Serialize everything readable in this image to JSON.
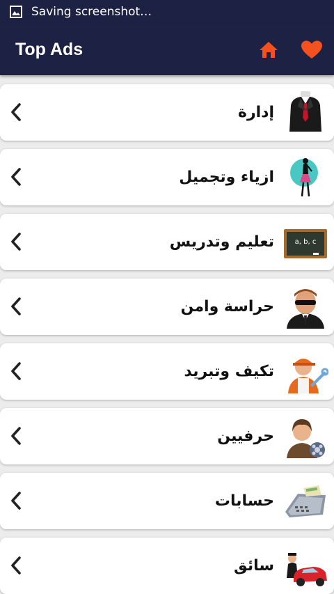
{
  "status_bar": {
    "text": "Saving screenshot…",
    "icon": "image-icon"
  },
  "app_bar": {
    "title": "Top Ads",
    "accent": "#f4511e",
    "home_icon": "home-icon",
    "favorite_icon": "heart-icon",
    "background": "#1d2143"
  },
  "categories": [
    {
      "label": "إدارة",
      "icon": "suit-tie-icon"
    },
    {
      "label": "ازياء وتجميل",
      "icon": "fashion-woman-icon"
    },
    {
      "label": "تعليم وتدريس",
      "icon": "chalkboard-icon"
    },
    {
      "label": "حراسة وامن",
      "icon": "security-guard-icon"
    },
    {
      "label": "تكيف وتبريد",
      "icon": "technician-wrench-icon"
    },
    {
      "label": "حرفيين",
      "icon": "craftswoman-icon"
    },
    {
      "label": "حسابات",
      "icon": "cash-register-icon"
    },
    {
      "label": "سائق",
      "icon": "driver-car-icon"
    }
  ]
}
